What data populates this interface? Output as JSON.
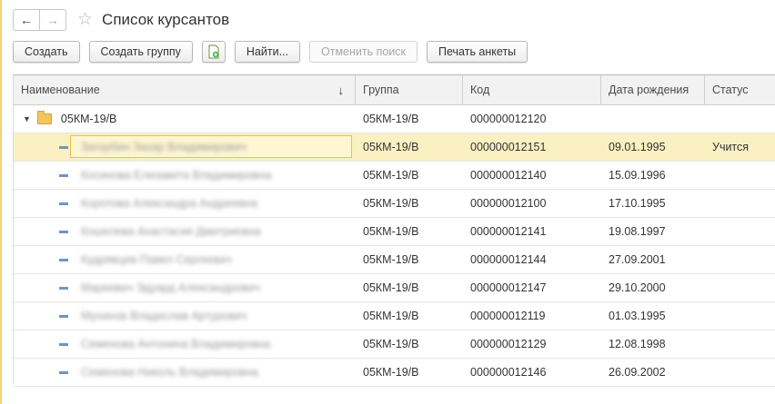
{
  "title": "Список курсантов",
  "toolbar": {
    "create": "Создать",
    "create_group": "Создать группу",
    "find": "Найти...",
    "cancel_search": "Отменить поиск",
    "print": "Печать анкеты"
  },
  "columns": {
    "name": "Наименование",
    "group": "Группа",
    "code": "Код",
    "birth": "Дата рождения",
    "status": "Статус"
  },
  "group_row": {
    "name": "05КМ-19/В",
    "group": "05КМ-19/В",
    "code": "000000012120"
  },
  "rows": [
    {
      "name": "Загорбин Захар Владимирович",
      "group": "05КМ-19/В",
      "code": "000000012151",
      "birth": "09.01.1995",
      "status": "Учится"
    },
    {
      "name": "Косинова Елизавета Владимировна",
      "group": "05КМ-19/В",
      "code": "000000012140",
      "birth": "15.09.1996",
      "status": ""
    },
    {
      "name": "Коротова Александра Андреевна",
      "group": "05КМ-19/В",
      "code": "000000012100",
      "birth": "17.10.1995",
      "status": ""
    },
    {
      "name": "Кошелева Анастасия Дмитриевна",
      "group": "05КМ-19/В",
      "code": "000000012141",
      "birth": "19.08.1997",
      "status": ""
    },
    {
      "name": "Кудрявцев Павел Сергеевич",
      "group": "05КМ-19/В",
      "code": "000000012144",
      "birth": "27.09.2001",
      "status": ""
    },
    {
      "name": "Маркевич Эдуард Александрович",
      "group": "05КМ-19/В",
      "code": "000000012147",
      "birth": "29.10.2000",
      "status": ""
    },
    {
      "name": "Мухинов Владислав Артурович",
      "group": "05КМ-19/В",
      "code": "000000012119",
      "birth": "01.03.1995",
      "status": ""
    },
    {
      "name": "Семенова Антонина Владимировна",
      "group": "05КМ-19/В",
      "code": "000000012129",
      "birth": "12.08.1998",
      "status": ""
    },
    {
      "name": "Семенова Николь Владимировна",
      "group": "05КМ-19/В",
      "code": "000000012146",
      "birth": "26.09.2002",
      "status": ""
    }
  ],
  "icons": {
    "back": "arrow-left-icon",
    "forward": "arrow-right-icon",
    "favorite": "star-icon",
    "group": "folder-icon",
    "item": "item-dash-icon"
  },
  "colors": {
    "selected_row": "#fbf0c2",
    "folder": "#f4c55a",
    "item_marker": "#6f93c6"
  }
}
